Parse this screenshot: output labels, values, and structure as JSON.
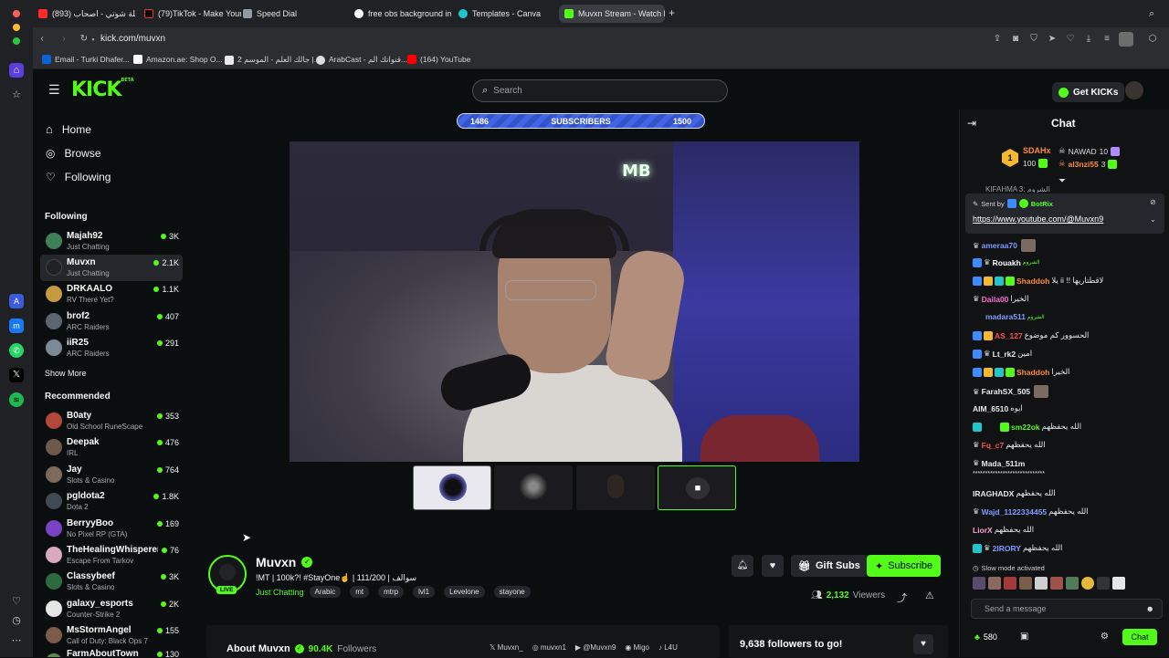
{
  "browser": {
    "tabs": [
      {
        "label": "(893) شيلة شوتي - اصحاب",
        "color": "#ff2a2a"
      },
      {
        "label": "(79)TikTok - Make Your",
        "color": "#000000"
      },
      {
        "label": "Speed Dial",
        "color": "#8f9aa5"
      },
      {
        "label": "free obs background ima",
        "color": "#ffffff"
      },
      {
        "label": "Templates - Canva",
        "color": "#20c4cb"
      },
      {
        "label": "Muvxn Stream - Watch l",
        "color": "#53fc18"
      }
    ],
    "url": "kick.com/muvxn",
    "bookmarks": [
      {
        "label": "Email - Turki Dhafer...",
        "color": "#0a64d6"
      },
      {
        "label": "Amazon.ae: Shop O...",
        "color": "#ffffff"
      },
      {
        "label": "جالك العلم - الموسم 2 |...",
        "color": "#e9e9e9"
      },
      {
        "label": "ArabCast - قنواتك الم...",
        "color": "#dddddd"
      },
      {
        "label": "(164) YouTube",
        "color": "#ff0000"
      }
    ]
  },
  "header": {
    "logo": "KICK",
    "logo_tag": "BETA",
    "search_placeholder": "Search",
    "get_kicks": "Get KICKs"
  },
  "sidebar": {
    "nav": [
      {
        "label": "Home",
        "icon": "home-icon"
      },
      {
        "label": "Browse",
        "icon": "compass-icon"
      },
      {
        "label": "Following",
        "icon": "heart-icon"
      }
    ],
    "following_title": "Following",
    "following": [
      {
        "name": "Majah92",
        "category": "Just Chatting",
        "viewers": "3K",
        "color": "#3c7f59"
      },
      {
        "name": "Muvxn",
        "category": "Just Chatting",
        "viewers": "2.1K",
        "color": "#202225"
      },
      {
        "name": "DRKAALO",
        "category": "RV There Yet?",
        "viewers": "1.1K",
        "color": "#c69a3f"
      },
      {
        "name": "brof2",
        "category": "ARC Raiders",
        "viewers": "407",
        "color": "#5c6670"
      },
      {
        "name": "iiR25",
        "category": "ARC Raiders",
        "viewers": "291",
        "color": "#7d8a95"
      }
    ],
    "show_more": "Show More",
    "recommended_title": "Recommended",
    "recommended": [
      {
        "name": "B0aty",
        "category": "Old School RuneScape",
        "viewers": "353",
        "color": "#b5473a"
      },
      {
        "name": "Deepak",
        "category": "IRL",
        "viewers": "476",
        "color": "#6d5a4c"
      },
      {
        "name": "Jay",
        "category": "Slots & Casino",
        "viewers": "764",
        "color": "#7c6a5d"
      },
      {
        "name": "pgldota2",
        "category": "Dota 2",
        "viewers": "1.8K",
        "color": "#3f4a55"
      },
      {
        "name": "BerryyBoo",
        "category": "No Pixel RP (GTA)",
        "viewers": "169",
        "color": "#7a42c4"
      },
      {
        "name": "TheHealingWhisperer",
        "category": "Escape From Tarkov",
        "viewers": "76",
        "color": "#d8a9c1"
      },
      {
        "name": "Classybeef",
        "category": "Slots & Casino",
        "viewers": "3K",
        "color": "#2d6b3f"
      },
      {
        "name": "galaxy_esports",
        "category": "Counter-Strike 2",
        "viewers": "2K",
        "color": "#e6e6e6"
      },
      {
        "name": "MsStormAngel",
        "category": "Call of Duty: Black Ops 7",
        "viewers": "155",
        "color": "#7b5b4a"
      },
      {
        "name": "FarmAboutTown",
        "category": "",
        "viewers": "130",
        "color": "#5d8a4f"
      }
    ]
  },
  "stream": {
    "subs_goal": {
      "current": "1486",
      "label": "SUBSCRIBERS",
      "target": "1500",
      "progress": 0.99
    },
    "channel_name": "Muvxn",
    "live_label": "LIVE",
    "title": "!MT | 100k?! #StayOne☝️ | 111/200 | سوالف",
    "category": "Just Chatting",
    "tags": [
      "Arabic",
      "mt",
      "mtrp",
      "lvl1",
      "Levelone",
      "stayone"
    ],
    "viewers": "2,132",
    "viewers_label": "Viewers",
    "gift_subs": "Gift Subs",
    "subscribe": "Subscribe",
    "about_label": "About Muvxn",
    "followers": "90.4K",
    "followers_label": "Followers",
    "socials": [
      "Muvxn_",
      "muvxn1",
      "@Muvxn9",
      "Migo",
      "L4U"
    ],
    "followers_goal": "9,638 followers to go!"
  },
  "chat": {
    "title": "Chat",
    "leaderboard": {
      "rank": "1",
      "first_name": "SDAHx",
      "first_count": "100",
      "second_name": "NAWAD",
      "second_count": "10",
      "third_name": "al3nzi55",
      "third_count": "3"
    },
    "pinned_partial": "KIFAHMA 3: الشروم",
    "pinned_by_label": "Sent by",
    "pinned_by": "BotRix",
    "pinned_link": "https://www.youtube.com/@Muvxn9",
    "messages": [
      {
        "user": "ameraa70",
        "color": "#7f9cff",
        "text": ""
      },
      {
        "user": "Rouakh",
        "color": "#ffffff",
        "text": "الشروم"
      },
      {
        "user": "Shaddoh",
        "color": "#ff8a3d",
        "text": "يلا ii !! لاقطتاريها"
      },
      {
        "user": "Daila00",
        "color": "#ff6bd6",
        "text": "الخيرا"
      },
      {
        "user": "madara511",
        "color": "#7f9cff",
        "text": "الشروم"
      },
      {
        "user": "AS_127",
        "color": "#ff4d4d",
        "text": "الحسوور كم موضوع"
      },
      {
        "user": "Lt_rk2",
        "color": "#e8eaed",
        "text": "امين"
      },
      {
        "user": "Shaddoh",
        "color": "#ff8a3d",
        "text": "الخيرا"
      },
      {
        "user": "FarahSX_505",
        "color": "#e8eaed",
        "text": ""
      },
      {
        "user": "AIM_6510",
        "color": "#e8eaed",
        "text": "ايوه"
      },
      {
        "user": "sm22ok",
        "color": "#53fc18",
        "text": "الله يحفظهم"
      },
      {
        "user": "Fq_c7",
        "color": "#ff4d4d",
        "text": "الله يحفظهم"
      },
      {
        "user": "Mada_511m",
        "color": "#e8eaed",
        "text": ""
      },
      {
        "user": "",
        "color": "#e8eaed",
        "text": "*****************************"
      },
      {
        "user": "IRAGHADX",
        "color": "#e8eaed",
        "text": "الله يحفظهم"
      },
      {
        "user": "Wajd_1122334455",
        "color": "#7f9cff",
        "text": "الله يحفظهم"
      },
      {
        "user": "LiorX",
        "color": "#ff9fd6",
        "text": "الله يحفظهم"
      },
      {
        "user": "2IRORY",
        "color": "#7f9cff",
        "text": "الله يحفظهم"
      }
    ],
    "slow_mode": "Slow mode activated",
    "input_placeholder": "Send a message",
    "kicks_count": "580",
    "chat_button": "Chat"
  }
}
